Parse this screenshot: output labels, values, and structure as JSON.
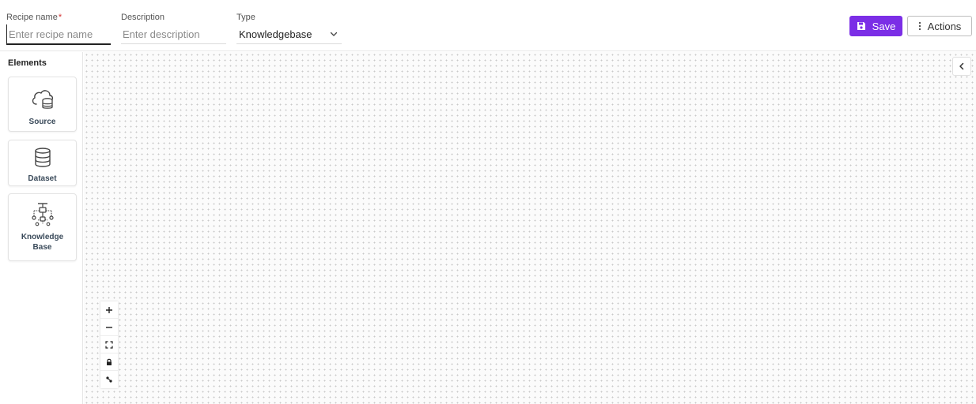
{
  "header": {
    "recipe_name": {
      "label": "Recipe name",
      "required_mark": "*",
      "value": "",
      "placeholder": "Enter recipe name"
    },
    "description": {
      "label": "Description",
      "value": "",
      "placeholder": "Enter description"
    },
    "type": {
      "label": "Type",
      "value": "Knowledgebase",
      "icon": "chevron-down-icon"
    },
    "save_label": "Save",
    "save_icon": "floppy-disk-icon",
    "actions_label": "Actions",
    "actions_icon": "vertical-dots-icon"
  },
  "sidebar": {
    "title": "Elements",
    "items": [
      {
        "label": "Source",
        "icon": "cloud-database-icon"
      },
      {
        "label": "Dataset",
        "icon": "database-icon"
      },
      {
        "label_line1": "Knowledge",
        "label_line2": "Base",
        "icon": "knowledge-graph-icon"
      }
    ]
  },
  "canvas": {
    "collapse_icon": "chevron-left-icon",
    "controls": [
      "zoom-in-icon",
      "zoom-out-icon",
      "fit-view-icon",
      "lock-icon",
      "interactivity-icon"
    ]
  },
  "colors": {
    "accent": "#7b2ee6",
    "required": "#d32f2f",
    "canvas_dot": "#c9c9c9"
  }
}
